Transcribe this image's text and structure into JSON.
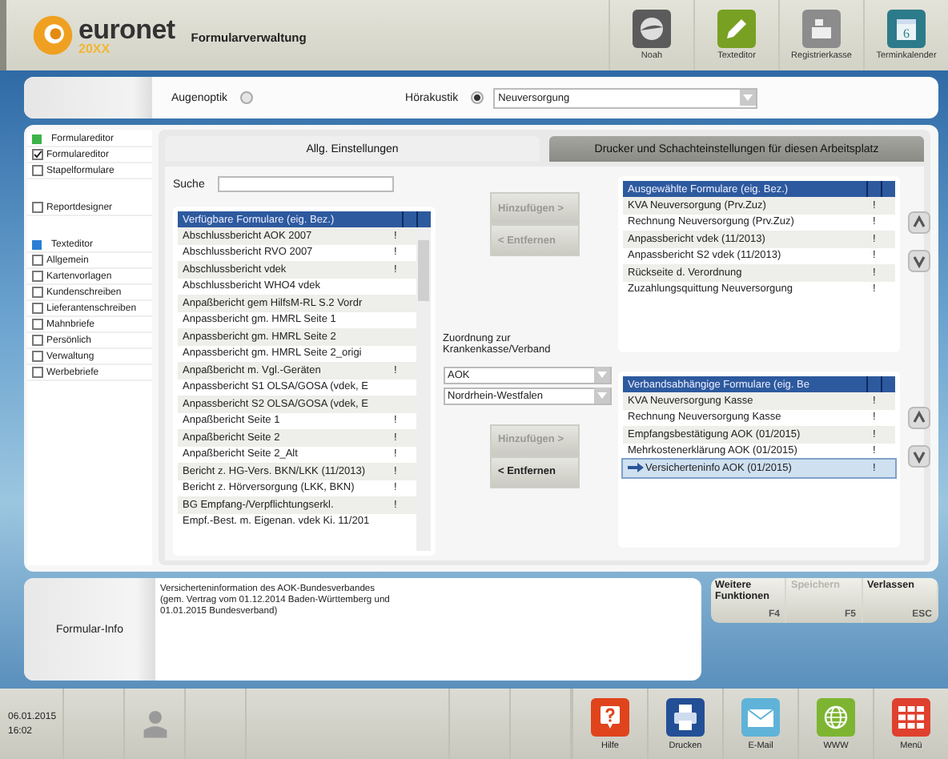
{
  "header": {
    "logo": {
      "name": "euronet",
      "sub": "20XX"
    },
    "title": "Formularverwaltung",
    "apps": [
      {
        "label": "Noah",
        "kind": "noah"
      },
      {
        "label": "Texteditor",
        "kind": "pencil"
      },
      {
        "label": "Registrierkasse",
        "kind": "register"
      },
      {
        "label": "Terminkalender",
        "kind": "calendar",
        "day": "6"
      }
    ]
  },
  "filter": {
    "options": [
      {
        "label": "Augenoptik",
        "selected": false
      },
      {
        "label": "Hörakustik",
        "selected": true
      }
    ],
    "select": {
      "value": "Neuversorgung"
    }
  },
  "sidebar": {
    "sections": [
      [
        {
          "kind": "group",
          "label": "Formulareditor",
          "color": "#3cb44a"
        },
        {
          "kind": "check",
          "label": "Formulareditor",
          "checked": true
        },
        {
          "kind": "check",
          "label": "Stapelformulare",
          "checked": false
        }
      ],
      [
        {
          "kind": "check",
          "label": "Reportdesigner",
          "checked": false
        }
      ],
      [
        {
          "kind": "group",
          "label": "Texteditor",
          "color": "#2a7fd4"
        },
        {
          "kind": "check",
          "label": "Allgemein",
          "checked": false
        },
        {
          "kind": "check",
          "label": "Kartenvorlagen",
          "checked": false
        },
        {
          "kind": "check",
          "label": "Kundenschreiben",
          "checked": false
        },
        {
          "kind": "check",
          "label": "Lieferantenschreiben",
          "checked": false
        },
        {
          "kind": "check",
          "label": "Mahnbriefe",
          "checked": false
        },
        {
          "kind": "check",
          "label": "Persönlich",
          "checked": false
        },
        {
          "kind": "check",
          "label": "Verwaltung",
          "checked": false
        },
        {
          "kind": "check",
          "label": "Werbebriefe",
          "checked": false
        }
      ]
    ]
  },
  "tabs": [
    {
      "label": "Allg. Einstellungen",
      "selected": true
    },
    {
      "label": "Drucker und Schachteinstellungen für diesen Arbeitsplatz",
      "selected": false
    }
  ],
  "search": {
    "label": "Suche"
  },
  "available": {
    "header": "Verfügbare Formulare (eig. Bez.)",
    "rows": [
      {
        "name": "Abschlussbericht AOK 2007",
        "flag": "!"
      },
      {
        "name": "Abschlussbericht RVO 2007",
        "flag": "!"
      },
      {
        "name": "Abschlussbericht vdek",
        "flag": "!"
      },
      {
        "name": "Abschlussbericht WHO4 vdek"
      },
      {
        "name": "Anpaßbericht gem HilfsM-RL S.2  Vordr"
      },
      {
        "name": "Anpassbericht gm. HMRL Seite 1"
      },
      {
        "name": "Anpassbericht gm. HMRL Seite 2"
      },
      {
        "name": "Anpassbericht gm. HMRL Seite 2_origi"
      },
      {
        "name": "Anpaßbericht m. Vgl.-Geräten",
        "flag": "!"
      },
      {
        "name": "Anpassbericht S1 OLSA/GOSA (vdek, E"
      },
      {
        "name": "Anpassbericht S2 OLSA/GOSA (vdek, E"
      },
      {
        "name": "Anpaßbericht Seite 1",
        "flag": "!"
      },
      {
        "name": "Anpaßbericht Seite 2",
        "flag": "!"
      },
      {
        "name": "Anpaßbericht Seite 2_Alt",
        "flag": "!"
      },
      {
        "name": "Bericht z. HG-Vers. BKN/LKK (11/2013)",
        "flag": "!"
      },
      {
        "name": "Bericht z. Hörversorgung (LKK, BKN)",
        "flag": "!"
      },
      {
        "name": "BG Empfang-/Verpflichtungserkl.",
        "flag": "!"
      },
      {
        "name": "Empf.-Best. m. Eigenan. vdek Ki. 11/201"
      }
    ]
  },
  "move_buttons": [
    {
      "label": "Hinzufügen >",
      "disabled": true
    },
    {
      "label": "< Entfernen",
      "disabled": true
    }
  ],
  "assignment": {
    "label": "Zuordnung zur Krankenkasse/Verband",
    "selects": [
      "AOK",
      "Nordrhein-Westfalen"
    ],
    "buttons": [
      {
        "label": "Hinzufügen >",
        "disabled": true
      },
      {
        "label": "< Entfernen",
        "disabled": false
      }
    ]
  },
  "selected_forms": {
    "header": "Ausgewählte Formulare (eig. Bez.)",
    "rows": [
      {
        "name": "KVA Neuversorgung (Prv.Zuz)",
        "flag": "!",
        "selected": false
      },
      {
        "name": "Rechnung Neuversorgung (Prv.Zuz)",
        "flag": "!",
        "selected": false
      },
      {
        "name": "Anpassbericht vdek (11/2013)",
        "flag": "!",
        "selected": false
      },
      {
        "name": "Anpassbericht S2 vdek (11/2013)",
        "flag": "!",
        "selected": false
      },
      {
        "name": "Rückseite d. Verordnung",
        "flag": "!",
        "selected": false
      },
      {
        "name": "Zuzahlungsquittung Neuversorgung",
        "flag": "!",
        "selected": false
      }
    ]
  },
  "association_forms": {
    "header": "Verbandsabhängige Formulare (eig. Be",
    "rows": [
      {
        "name": "KVA Neuversorgung Kasse",
        "flag": "!",
        "selected": false
      },
      {
        "name": "Rechnung Neuversorgung Kasse",
        "flag": "!",
        "selected": false
      },
      {
        "name": "Empfangsbestätigung AOK (01/2015)",
        "flag": "!",
        "selected": false
      },
      {
        "name": "Mehrkostenerklärung AOK (01/2015)",
        "flag": "!",
        "selected": false
      },
      {
        "name": "Versicherteninfo AOK (01/2015)",
        "flag": "!",
        "selected": true
      }
    ]
  },
  "info": {
    "label": "Formular-Info",
    "lines": [
      "Versicherteninformation des AOK-Bundesverbandes",
      "(gem. Vertrag vom 01.12.2014 Baden-Württemberg und",
      "01.01.2015 Bundesverband)"
    ]
  },
  "function_keys": [
    {
      "label": "Weitere Funktionen",
      "key": "F4",
      "disabled": false
    },
    {
      "label": "Speichern",
      "key": "F5",
      "disabled": true
    },
    {
      "label": "Verlassen",
      "key": "ESC",
      "disabled": false
    }
  ],
  "footer": {
    "date": "06.01.2015",
    "time": "16:02",
    "tools": [
      {
        "label": "Hilfe",
        "kind": "help"
      },
      {
        "label": "Drucken",
        "kind": "print"
      },
      {
        "label": "E-Mail",
        "kind": "mail"
      },
      {
        "label": "WWW",
        "kind": "web"
      },
      {
        "label": "Menü",
        "kind": "menu"
      }
    ]
  }
}
